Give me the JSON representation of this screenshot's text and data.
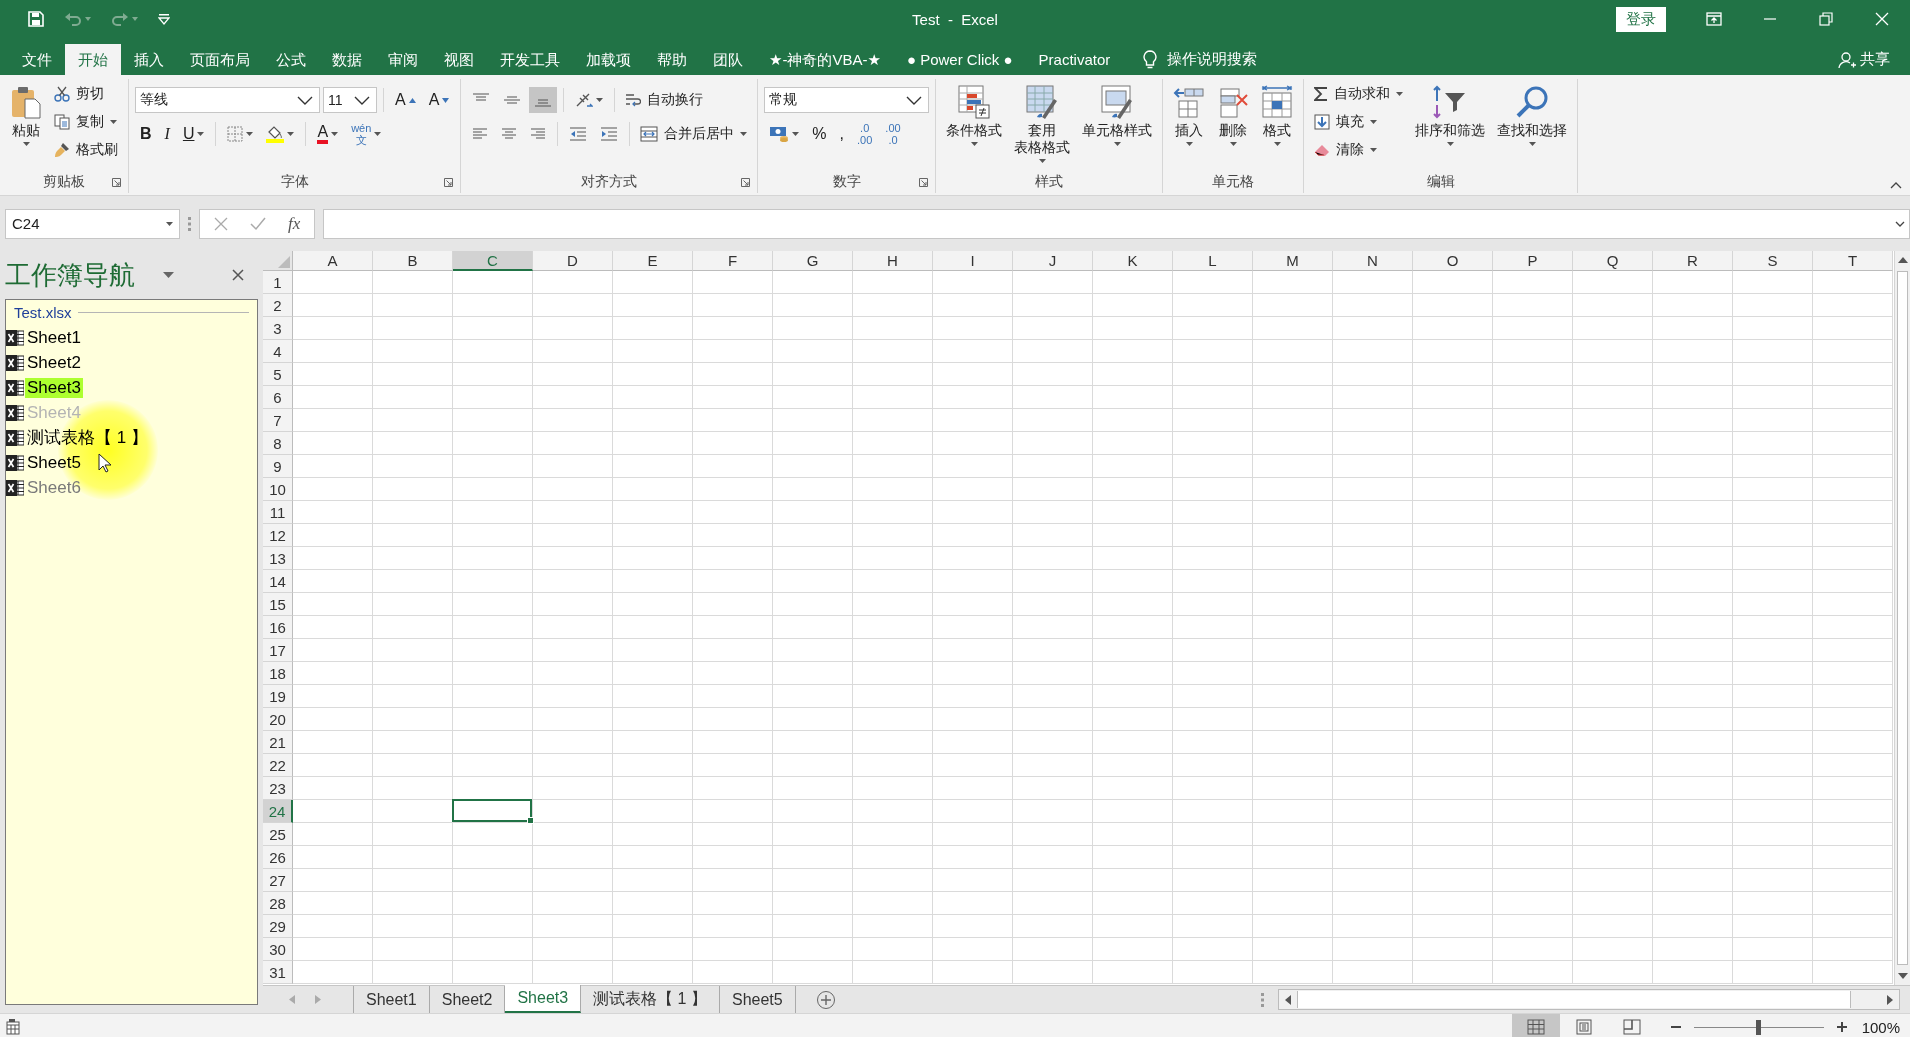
{
  "title_bar": {
    "title": "Test  -  Excel",
    "sign_in": "登录",
    "quick_access": [
      {
        "disabled": false
      },
      {
        "disabled": true
      },
      {
        "disabled": true
      },
      {
        "disabled": false
      }
    ]
  },
  "menu_tabs": [
    {
      "label": "文件",
      "selected": false
    },
    {
      "label": "开始",
      "selected": true
    },
    {
      "label": "插入",
      "selected": false
    },
    {
      "label": "页面布局",
      "selected": false
    },
    {
      "label": "公式",
      "selected": false
    },
    {
      "label": "数据",
      "selected": false
    },
    {
      "label": "审阅",
      "selected": false
    },
    {
      "label": "视图",
      "selected": false
    },
    {
      "label": "开发工具",
      "selected": false
    },
    {
      "label": "加载项",
      "selected": false
    },
    {
      "label": "帮助",
      "selected": false
    },
    {
      "label": "团队",
      "selected": false
    },
    {
      "label": "★-神奇的VBA-★",
      "selected": false
    },
    {
      "label": "● Power Click ●",
      "selected": false
    },
    {
      "label": "Practivator",
      "selected": false
    }
  ],
  "tell_me": "操作说明搜索",
  "share": "共享",
  "ribbon": {
    "groups": [
      {
        "label": "剪贴板",
        "launcher": true,
        "columns": [
          [
            {
              "kind": "large",
              "label": "粘贴"
            }
          ],
          [
            {
              "kind": "small",
              "label": "剪切"
            },
            {
              "kind": "small",
              "label": "复制"
            },
            {
              "kind": "small",
              "label": "格式刷"
            }
          ]
        ]
      },
      {
        "label": "字体",
        "launcher": true,
        "rows": [
          [
            {
              "kind": "dropdown",
              "value": "等线"
            },
            {
              "kind": "dropdown",
              "value": "11"
            },
            {
              "kind": "tool",
              "label": "A",
              "selected": false
            },
            {
              "kind": "tool",
              "label": "A",
              "selected": false
            }
          ],
          [
            {
              "kind": "tool",
              "label": "B",
              "selected": false
            },
            {
              "kind": "tool",
              "label": "I",
              "selected": false
            },
            {
              "kind": "tool",
              "label": "U",
              "selected": false
            },
            {
              "kind": "tool",
              "selected": false
            },
            {
              "kind": "tool",
              "selected": false
            },
            {
              "kind": "tool",
              "label": "A",
              "selected": false
            },
            {
              "kind": "tool",
              "lines": [
                "wén",
                "文"
              ],
              "selected": false
            }
          ]
        ]
      },
      {
        "label": "对齐方式",
        "launcher": true,
        "rows": [
          [
            {
              "kind": "tool",
              "selected": false
            },
            {
              "kind": "tool",
              "selected": false
            },
            {
              "kind": "tool",
              "selected": true
            },
            {
              "kind": "tool",
              "selected": false
            },
            {
              "kind": "small",
              "label": "自动换行"
            }
          ],
          [
            {
              "kind": "tool",
              "selected": false
            },
            {
              "kind": "tool",
              "selected": false
            },
            {
              "kind": "tool",
              "selected": false
            },
            {
              "kind": "tool",
              "selected": false
            },
            {
              "kind": "tool",
              "selected": false
            },
            {
              "kind": "small",
              "label": "合并后居中"
            }
          ]
        ]
      },
      {
        "label": "数字",
        "launcher": true,
        "rows": [
          [
            {
              "kind": "dropdown",
              "value": "常规"
            }
          ],
          [
            {
              "kind": "tool",
              "selected": false
            },
            {
              "kind": "tool",
              "label": "%",
              "selected": false
            },
            {
              "kind": "tool",
              "label": ",",
              "selected": false
            },
            {
              "kind": "tool",
              "lines": [
                ".0",
                ".00"
              ],
              "selected": false
            },
            {
              "kind": "tool",
              "lines": [
                ".00",
                ".0"
              ],
              "selected": false
            }
          ]
        ]
      },
      {
        "label": "样式",
        "columns": [
          [
            {
              "kind": "large",
              "label": "条件格式"
            }
          ],
          [
            {
              "kind": "large",
              "lines": [
                "套用",
                "表格格式"
              ]
            }
          ],
          [
            {
              "kind": "large",
              "label": "单元格样式"
            }
          ]
        ]
      },
      {
        "label": "单元格",
        "columns": [
          [
            {
              "kind": "large",
              "label": "插入"
            }
          ],
          [
            {
              "kind": "large",
              "label": "删除"
            }
          ],
          [
            {
              "kind": "large",
              "label": "格式"
            }
          ]
        ]
      },
      {
        "label": "编辑",
        "columns": [
          [
            {
              "kind": "small",
              "label": "自动求和"
            },
            {
              "kind": "small",
              "label": "填充"
            },
            {
              "kind": "small",
              "label": "清除"
            }
          ],
          [
            {
              "kind": "large",
              "label": "排序和筛选"
            }
          ],
          [
            {
              "kind": "large",
              "label": "查找和选择"
            }
          ]
        ]
      }
    ]
  },
  "formula_bar": {
    "name_box": "C24",
    "fx": "fx"
  },
  "navigator": {
    "title": "工作簿导航",
    "workbook": "Test.xlsx",
    "sheets": [
      {
        "name": "Sheet1",
        "kind": "visible",
        "selected": false
      },
      {
        "name": "Sheet2",
        "kind": "visible",
        "selected": false
      },
      {
        "name": "Sheet3",
        "kind": "visible",
        "selected": true
      },
      {
        "name": "Sheet4",
        "kind": "hidden",
        "selected": false
      },
      {
        "name": "测试表格【 1 】",
        "kind": "visible",
        "selected": false
      },
      {
        "name": "Sheet5",
        "kind": "visible",
        "selected": false
      },
      {
        "name": "Sheet6",
        "kind": "veryhidden",
        "selected": false
      }
    ]
  },
  "grid": {
    "columns": [
      {
        "label": "A",
        "selected": false
      },
      {
        "label": "B",
        "selected": false
      },
      {
        "label": "C",
        "selected": true
      },
      {
        "label": "D",
        "selected": false
      },
      {
        "label": "E",
        "selected": false
      },
      {
        "label": "F",
        "selected": false
      },
      {
        "label": "G",
        "selected": false
      },
      {
        "label": "H",
        "selected": false
      },
      {
        "label": "I",
        "selected": false
      },
      {
        "label": "J",
        "selected": false
      },
      {
        "label": "K",
        "selected": false
      },
      {
        "label": "L",
        "selected": false
      },
      {
        "label": "M",
        "selected": false
      },
      {
        "label": "N",
        "selected": false
      },
      {
        "label": "O",
        "selected": false
      },
      {
        "label": "P",
        "selected": false
      },
      {
        "label": "Q",
        "selected": false
      },
      {
        "label": "R",
        "selected": false
      },
      {
        "label": "S",
        "selected": false
      },
      {
        "label": "T",
        "selected": false
      }
    ],
    "rows": [
      {
        "label": "1",
        "selected": false
      },
      {
        "label": "2",
        "selected": false
      },
      {
        "label": "3",
        "selected": false
      },
      {
        "label": "4",
        "selected": false
      },
      {
        "label": "5",
        "selected": false
      },
      {
        "label": "6",
        "selected": false
      },
      {
        "label": "7",
        "selected": false
      },
      {
        "label": "8",
        "selected": false
      },
      {
        "label": "9",
        "selected": false
      },
      {
        "label": "10",
        "selected": false
      },
      {
        "label": "11",
        "selected": false
      },
      {
        "label": "12",
        "selected": false
      },
      {
        "label": "13",
        "selected": false
      },
      {
        "label": "14",
        "selected": false
      },
      {
        "label": "15",
        "selected": false
      },
      {
        "label": "16",
        "selected": false
      },
      {
        "label": "17",
        "selected": false
      },
      {
        "label": "18",
        "selected": false
      },
      {
        "label": "19",
        "selected": false
      },
      {
        "label": "20",
        "selected": false
      },
      {
        "label": "21",
        "selected": false
      },
      {
        "label": "22",
        "selected": false
      },
      {
        "label": "23",
        "selected": false
      },
      {
        "label": "24",
        "selected": true
      },
      {
        "label": "25",
        "selected": false
      },
      {
        "label": "26",
        "selected": false
      },
      {
        "label": "27",
        "selected": false
      },
      {
        "label": "28",
        "selected": false
      },
      {
        "label": "29",
        "selected": false
      },
      {
        "label": "30",
        "selected": false
      },
      {
        "label": "31",
        "selected": false
      }
    ]
  },
  "sheet_tabs": [
    {
      "label": "Sheet1",
      "selected": false
    },
    {
      "label": "Sheet2",
      "selected": false
    },
    {
      "label": "Sheet3",
      "selected": true
    },
    {
      "label": "测试表格【 1 】",
      "selected": false
    },
    {
      "label": "Sheet5",
      "selected": false
    }
  ],
  "status_bar": {
    "views": [
      {
        "selected": true
      },
      {
        "selected": false
      },
      {
        "selected": false
      }
    ],
    "zoom_slider": {
      "level": 0.5
    },
    "zoom": "100%"
  }
}
